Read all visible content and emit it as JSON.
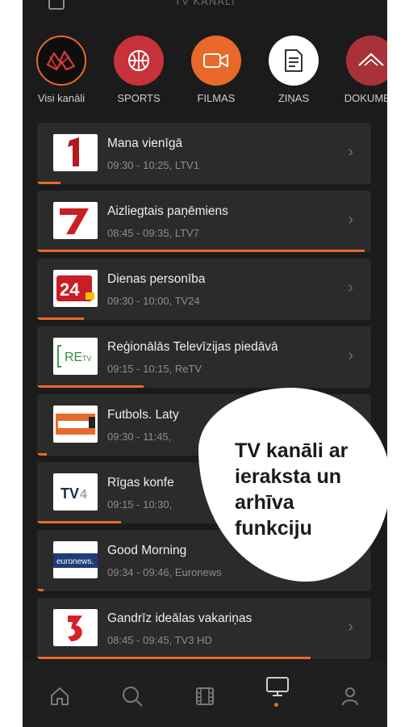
{
  "header": {
    "title": "TV KANĀLI",
    "menu_icon": "list-icon"
  },
  "categories": [
    {
      "label": "Visi kanāli",
      "icon": "all-channels-icon",
      "color": "#0e0e0e",
      "active": true
    },
    {
      "label": "SPORTS",
      "icon": "basketball-icon",
      "color": "#c8323a"
    },
    {
      "label": "FILMAS",
      "icon": "video-camera-icon",
      "color": "#e8692a"
    },
    {
      "label": "ZIŅAS",
      "icon": "document-icon",
      "color": "#ffffff"
    },
    {
      "label": "DOKUMEN",
      "icon": "mountain-icon",
      "color": "#a9323a"
    }
  ],
  "channels": [
    {
      "title": "Mana vienīgā",
      "meta": "09:30 - 10:25, LTV1",
      "logo": "LTV1",
      "progress": 0.07
    },
    {
      "title": "Aizliegtais paņēmiens",
      "meta": "08:45 - 09:35, LTV7",
      "logo": "LTV7",
      "progress": 0.98
    },
    {
      "title": "Dienas personība",
      "meta": "09:30 - 10:00, TV24",
      "logo": "TV24",
      "progress": 0.14
    },
    {
      "title": "Reģionālās Televīzijas piedāvā",
      "meta": "09:15 - 10:15, ReTV",
      "logo": "ReTV",
      "progress": 0.32
    },
    {
      "title": "Futbols. Laty",
      "meta": "09:30 - 11:45,",
      "logo": "Sportacentrs.tv",
      "progress": 0.03
    },
    {
      "title": "Rīgas konfe",
      "meta": "09:15 - 10:30,",
      "logo": "TV4",
      "progress": 0.25
    },
    {
      "title": "Good Morning",
      "meta": "09:34 - 09:46, Euronews",
      "logo": "euronews",
      "progress": 0.02
    },
    {
      "title": "Gandrīz ideālas vakariņas",
      "meta": "08:45 - 09:45, TV3 HD",
      "logo": "TV3",
      "progress": 0.82
    }
  ],
  "overlay_text": "TV kanāli ar ieraksta un arhīva funkciju",
  "nav": [
    {
      "icon": "home-icon"
    },
    {
      "icon": "search-icon"
    },
    {
      "icon": "film-icon"
    },
    {
      "icon": "tv-icon",
      "active": true
    },
    {
      "icon": "profile-icon"
    }
  ],
  "accent": "#e8692a"
}
